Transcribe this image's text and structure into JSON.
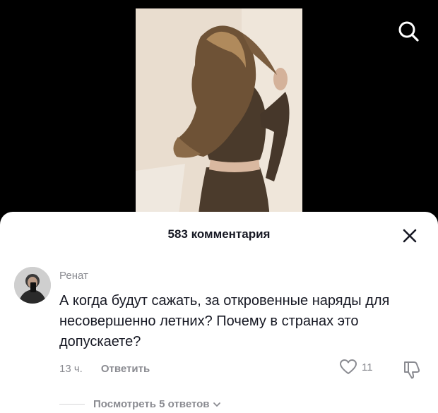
{
  "video": {
    "search_icon": "search-icon"
  },
  "comments_sheet": {
    "title": "583 комментария",
    "close_icon": "close-icon",
    "comment": {
      "author": "Ренат",
      "text": "А когда будут сажать, за откровенные наряды для несовершенно летних? Почему в странах это допускаете?",
      "time": "13 ч.",
      "reply_label": "Ответить",
      "likes": "11",
      "like_icon": "heart-icon",
      "dislike_icon": "thumbs-down-icon"
    },
    "view_replies": "Посмотреть 5 ответов",
    "view_replies_icon": "chevron-down-icon"
  },
  "colors": {
    "background": "#000000",
    "sheet": "#ffffff",
    "primary_text": "#161823",
    "secondary_text": "#8a8b91"
  }
}
